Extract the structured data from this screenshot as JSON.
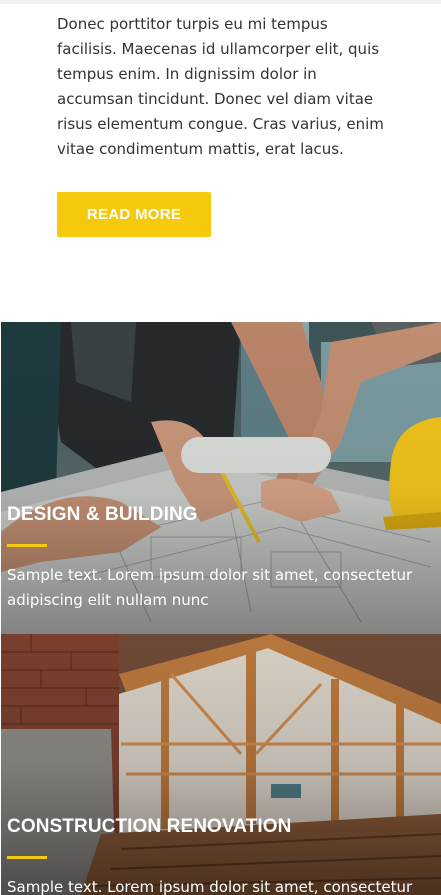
{
  "intro": {
    "text": "Donec porttitor turpis eu mi tempus facilisis. Maecenas id ullamcorper elit, quis tempus enim. In dignissim dolor in accumsan tincidunt. Donec vel diam vitae risus elementum congue. Cras varius, enim vitae condimentum mattis, erat lacus."
  },
  "read_more_label": "READ MORE",
  "cards": [
    {
      "title": "DESIGN & BUILDING",
      "text": "Sample text. Lorem ipsum dolor sit amet, consectetur adipiscing elit nullam nunc"
    },
    {
      "title": "CONSTRUCTION RENOVATION",
      "text": "Sample text. Lorem ipsum dolor sit amet, consectetur"
    }
  ],
  "colors": {
    "accent": "#f5c90c",
    "text": "#333333"
  }
}
